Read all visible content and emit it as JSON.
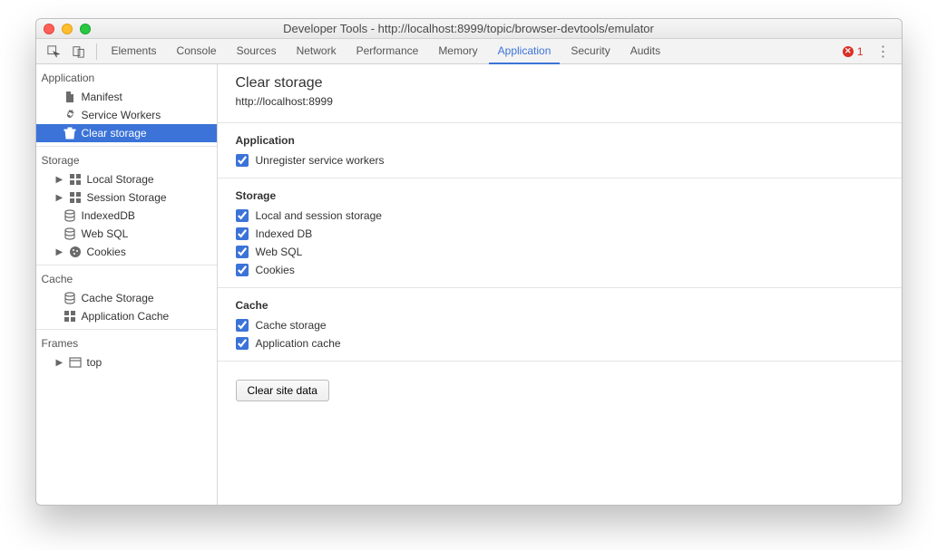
{
  "window": {
    "title": "Developer Tools - http://localhost:8999/topic/browser-devtools/emulator"
  },
  "toolbar": {
    "tabs": [
      "Elements",
      "Console",
      "Sources",
      "Network",
      "Performance",
      "Memory",
      "Application",
      "Security",
      "Audits"
    ],
    "activeTab": "Application",
    "errorCount": "1"
  },
  "sidebar": {
    "sections": {
      "application": {
        "title": "Application",
        "items": [
          {
            "label": "Manifest",
            "icon": "file",
            "indent": "nodisc"
          },
          {
            "label": "Service Workers",
            "icon": "gear",
            "indent": "nodisc"
          },
          {
            "label": "Clear storage",
            "icon": "trash",
            "indent": "nodisc",
            "selected": true
          }
        ]
      },
      "storage": {
        "title": "Storage",
        "items": [
          {
            "label": "Local Storage",
            "icon": "grid",
            "disclosure": "▶",
            "indent": "indent1"
          },
          {
            "label": "Session Storage",
            "icon": "grid",
            "disclosure": "▶",
            "indent": "indent1"
          },
          {
            "label": "IndexedDB",
            "icon": "db",
            "indent": "nodisc"
          },
          {
            "label": "Web SQL",
            "icon": "db",
            "indent": "nodisc"
          },
          {
            "label": "Cookies",
            "icon": "cookie",
            "disclosure": "▶",
            "indent": "indent1"
          }
        ]
      },
      "cache": {
        "title": "Cache",
        "items": [
          {
            "label": "Cache Storage",
            "icon": "db",
            "indent": "nodisc"
          },
          {
            "label": "Application Cache",
            "icon": "grid",
            "indent": "nodisc"
          }
        ]
      },
      "frames": {
        "title": "Frames",
        "items": [
          {
            "label": "top",
            "icon": "window",
            "disclosure": "▶",
            "indent": "indent1"
          }
        ]
      }
    }
  },
  "main": {
    "heading": "Clear storage",
    "origin": "http://localhost:8999",
    "groups": [
      {
        "title": "Application",
        "checks": [
          {
            "label": "Unregister service workers",
            "checked": true
          }
        ]
      },
      {
        "title": "Storage",
        "checks": [
          {
            "label": "Local and session storage",
            "checked": true
          },
          {
            "label": "Indexed DB",
            "checked": true
          },
          {
            "label": "Web SQL",
            "checked": true
          },
          {
            "label": "Cookies",
            "checked": true
          }
        ]
      },
      {
        "title": "Cache",
        "checks": [
          {
            "label": "Cache storage",
            "checked": true
          },
          {
            "label": "Application cache",
            "checked": true
          }
        ]
      }
    ],
    "clearButton": "Clear site data"
  }
}
